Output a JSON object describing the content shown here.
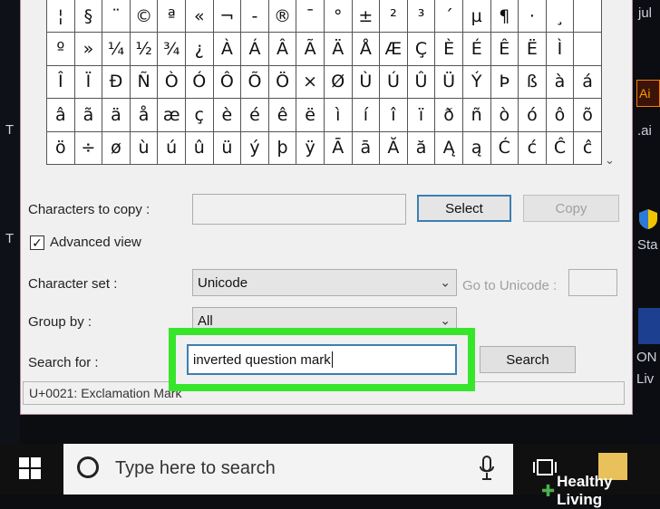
{
  "desktop": {
    "left_label_1": "T",
    "left_label_2": "T",
    "right_labels": [
      "jul",
      "Ai",
      ".ai",
      "Sta",
      "ON",
      "Liv"
    ]
  },
  "char_grid": {
    "rows": [
      [
        "¦",
        "§",
        "¨",
        "©",
        "ª",
        "«",
        "¬",
        "-",
        "®",
        "¯",
        "°",
        "±",
        "²",
        "³",
        "´",
        "µ",
        "¶",
        "·",
        "¸",
        ""
      ],
      [
        "º",
        "»",
        "¼",
        "½",
        "¾",
        "¿",
        "À",
        "Á",
        "Â",
        "Ã",
        "Ä",
        "Å",
        "Æ",
        "Ç",
        "È",
        "É",
        "Ê",
        "Ë",
        "Ì",
        ""
      ],
      [
        "Î",
        "Ï",
        "Ð",
        "Ñ",
        "Ò",
        "Ó",
        "Ô",
        "Õ",
        "Ö",
        "×",
        "Ø",
        "Ù",
        "Ú",
        "Û",
        "Ü",
        "Ý",
        "Þ",
        "ß",
        "à",
        "á"
      ],
      [
        "â",
        "ã",
        "ä",
        "å",
        "æ",
        "ç",
        "è",
        "é",
        "ê",
        "ë",
        "ì",
        "í",
        "î",
        "ï",
        "ð",
        "ñ",
        "ò",
        "ó",
        "ô",
        "õ"
      ],
      [
        "ö",
        "÷",
        "ø",
        "ù",
        "ú",
        "û",
        "ü",
        "ý",
        "þ",
        "ÿ",
        "Ā",
        "ā",
        "Ă",
        "ă",
        "Ą",
        "ą",
        "Ć",
        "ć",
        "Ĉ",
        "ĉ"
      ]
    ],
    "scroll_icon": "chevron-down-icon"
  },
  "copy": {
    "label": "Characters to copy :",
    "value": "",
    "select_button": "Select",
    "copy_button": "Copy"
  },
  "advanced_view": {
    "label": "Advanced view",
    "checked": true,
    "check_glyph": "✓"
  },
  "character_set": {
    "label": "Character set :",
    "value": "Unicode",
    "goto_label": "Go to Unicode :",
    "goto_value": ""
  },
  "group_by": {
    "label": "Group by :",
    "value": "All"
  },
  "search": {
    "label": "Search for :",
    "value": "inverted question mark",
    "button": "Search"
  },
  "status": {
    "text": "U+0021: Exclamation Mark"
  },
  "taskbar": {
    "search_placeholder": "Type here to search"
  },
  "watermark": {
    "plus": "✚",
    "text": "Healthy Living"
  },
  "colors": {
    "highlight": "#37e62b",
    "accent": "#3c7fb1"
  }
}
